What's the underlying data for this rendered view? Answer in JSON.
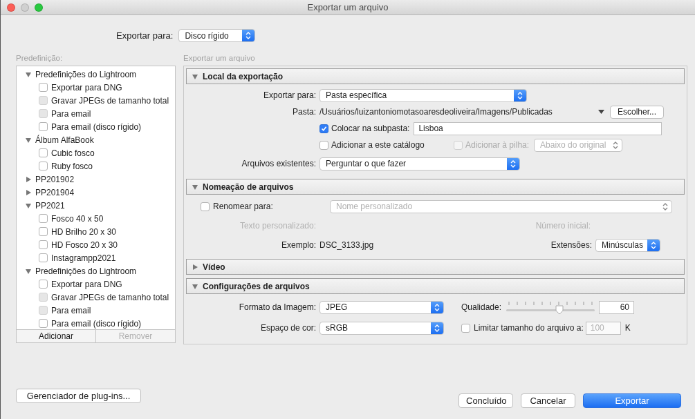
{
  "window": {
    "title": "Exportar um arquivo"
  },
  "export_to": {
    "label": "Exportar para:",
    "value": "Disco rígido"
  },
  "preset_panel": {
    "label": "Predefinição:",
    "groups": [
      {
        "name": "Predefinições do Lightroom",
        "expanded": true,
        "children": [
          {
            "name": "Exportar para DNG",
            "checked": false,
            "disabled": false
          },
          {
            "name": "Gravar JPEGs de tamanho total",
            "checked": false,
            "disabled": true
          },
          {
            "name": "Para email",
            "checked": false,
            "disabled": true
          },
          {
            "name": "Para email (disco rígido)",
            "checked": false,
            "disabled": false
          }
        ]
      },
      {
        "name": "Álbum AlfaBook",
        "expanded": true,
        "children": [
          {
            "name": "Cubic fosco",
            "checked": false,
            "disabled": false
          },
          {
            "name": "Ruby fosco",
            "checked": false,
            "disabled": false
          }
        ]
      },
      {
        "name": "PP201902",
        "expanded": false
      },
      {
        "name": "PP201904",
        "expanded": false
      },
      {
        "name": "PP2021",
        "expanded": true,
        "children": [
          {
            "name": "Fosco 40 x 50",
            "checked": false,
            "disabled": false
          },
          {
            "name": "HD Brilho 20 x 30",
            "checked": false,
            "disabled": false
          },
          {
            "name": "HD Fosco 20 x 30",
            "checked": false,
            "disabled": false
          },
          {
            "name": "Instagrampp2021",
            "checked": false,
            "disabled": false
          }
        ]
      },
      {
        "name": "Predefinições do Lightroom",
        "expanded": true,
        "children": [
          {
            "name": "Exportar para DNG",
            "checked": false,
            "disabled": false
          },
          {
            "name": "Gravar JPEGs de tamanho total",
            "checked": false,
            "disabled": true
          },
          {
            "name": "Para email",
            "checked": false,
            "disabled": true
          },
          {
            "name": "Para email (disco rígido)",
            "checked": false,
            "disabled": false
          }
        ]
      }
    ],
    "add_button": {
      "label": "Adicionar",
      "disabled": false
    },
    "remove_button": {
      "label": "Remover",
      "disabled": true
    }
  },
  "main_label": "Exportar um arquivo",
  "sections": [
    {
      "kind": "location",
      "title": "Local da exportação",
      "expanded": true,
      "export_to": {
        "label": "Exportar para:",
        "value": "Pasta específica"
      },
      "folder": {
        "label": "Pasta:",
        "path": "/Usuários/luizantoniomotasoaresdeoliveira/Imagens/Publicadas",
        "button": "Escolher..."
      },
      "subfolder": {
        "label": "Colocar na subpasta:",
        "checked": true,
        "value": "Lisboa"
      },
      "add_catalog": {
        "label": "Adicionar a este catálogo",
        "checked": false
      },
      "add_stack": {
        "label": "Adicionar à pilha:",
        "checked": false,
        "disabled": true,
        "value": "Abaixo do original"
      },
      "existing": {
        "label": "Arquivos existentes:",
        "value": "Perguntar o que fazer"
      }
    },
    {
      "kind": "naming",
      "title": "Nomeação de arquivos",
      "expanded": true,
      "rename": {
        "label": "Renomear para:",
        "checked": false,
        "value": "Nome personalizado"
      },
      "custom_text": {
        "label": "Texto personalizado:"
      },
      "start_number": {
        "label": "Número inicial:"
      },
      "example": {
        "label": "Exemplo:",
        "value": "DSC_3133.jpg"
      },
      "extensions": {
        "label": "Extensões:",
        "value": "Minúsculas"
      }
    },
    {
      "kind": "video",
      "title": "Vídeo",
      "expanded": false
    },
    {
      "kind": "file_settings",
      "title": "Configurações de arquivos",
      "expanded": true,
      "format": {
        "label": "Formato da Imagem:",
        "value": "JPEG"
      },
      "quality": {
        "label": "Qualidade:",
        "level": 0.6,
        "value": "60"
      },
      "color_space": {
        "label": "Espaço de cor:",
        "value": "sRGB"
      },
      "limit": {
        "label": "Limitar tamanho do arquivo a:",
        "checked": false,
        "value": "100",
        "unit": "K"
      }
    }
  ],
  "plugin_button": "Gerenciador de plug-ins...",
  "buttons": [
    {
      "label": "Concluído",
      "kind": "default"
    },
    {
      "label": "Cancelar",
      "kind": "default"
    },
    {
      "label": "Exportar",
      "kind": "primary"
    }
  ]
}
